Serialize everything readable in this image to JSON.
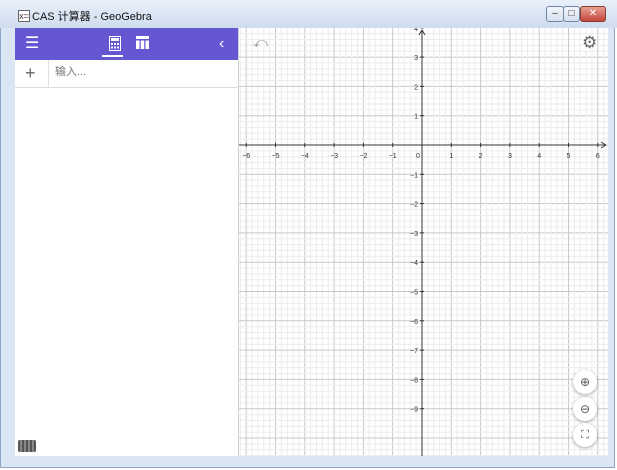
{
  "window": {
    "title": "CAS 计算器 - GeoGebra",
    "app_icon": "x=",
    "min_glyph": "–",
    "max_glyph": "□",
    "close_glyph": "✕"
  },
  "toolbar": {
    "menu_icon": "menu-icon",
    "calculator_icon": "calculator-icon",
    "table_icon": "table-icon",
    "collapse_icon": "chevron-left-icon",
    "accent_color": "#6557d2"
  },
  "algebra": {
    "add_glyph": "+",
    "input_placeholder": "输入..."
  },
  "graphics": {
    "x_ticks": [
      "−6",
      "−5",
      "−4",
      "−3",
      "−2",
      "−1",
      "0",
      "1",
      "2",
      "3",
      "4",
      "5",
      "6"
    ],
    "y_ticks_pos": [
      "4",
      "3",
      "2",
      "1"
    ],
    "y_ticks_neg": [
      "−1",
      "−2",
      "−3",
      "−4",
      "−5",
      "−6",
      "−7",
      "−8",
      "−9"
    ]
  }
}
